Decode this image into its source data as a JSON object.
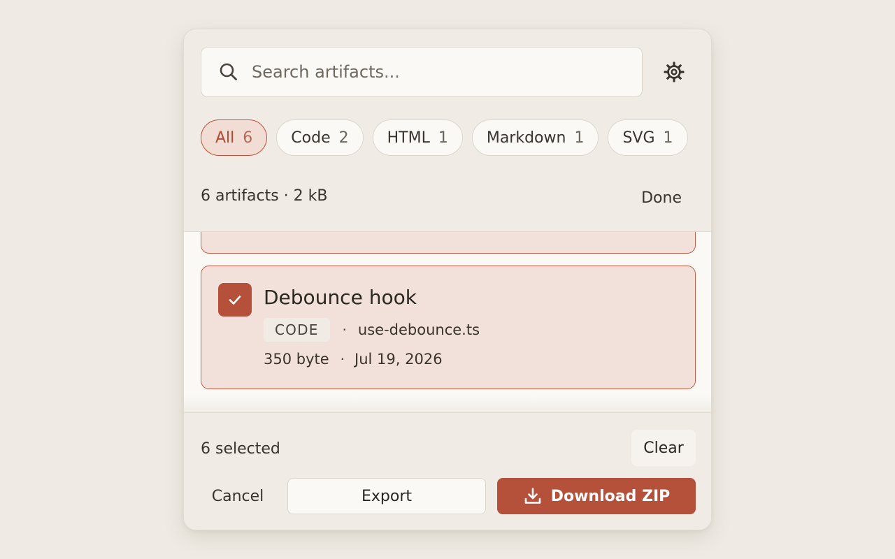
{
  "search": {
    "placeholder": "Search artifacts..."
  },
  "filters": [
    {
      "label": "All",
      "count": "6",
      "active": true
    },
    {
      "label": "Code",
      "count": "2",
      "active": false
    },
    {
      "label": "HTML",
      "count": "1",
      "active": false
    },
    {
      "label": "Markdown",
      "count": "1",
      "active": false
    },
    {
      "label": "SVG",
      "count": "1",
      "active": false
    }
  ],
  "summary": {
    "text": "6 artifacts · 2 kB",
    "done_label": "Done"
  },
  "artifacts": [
    {
      "title": "Debounce hook",
      "type": "CODE",
      "separator": "·",
      "filename": "use-debounce.ts",
      "size": "350 byte",
      "date": "Jul 19, 2026",
      "selected": true
    }
  ],
  "footer": {
    "selected_text": "6 selected",
    "clear_label": "Clear",
    "cancel_label": "Cancel",
    "export_label": "Export",
    "download_label": "Download ZIP"
  },
  "icons": {
    "search": "search-icon",
    "settings": "gear-icon",
    "check": "check-icon",
    "download": "download-icon"
  },
  "colors": {
    "accent": "#b5503b",
    "accent_soft": "#f2e1da",
    "background": "#efebe4",
    "panel": "#f0ece5"
  }
}
